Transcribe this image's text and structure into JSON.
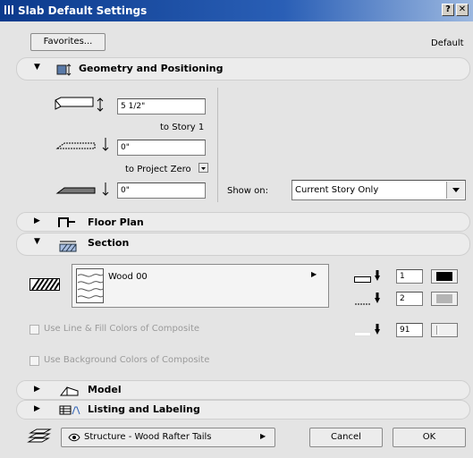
{
  "window": {
    "title": "Slab Default Settings",
    "help_label": "?",
    "close_label": "✕"
  },
  "top": {
    "favorites_label": "Favorites...",
    "mode_label": "Default"
  },
  "geometry": {
    "title": "Geometry and Positioning",
    "thickness_value": "5 1/2\"",
    "to_story_label": "to Story 1",
    "offset1_value": "0\"",
    "to_project_zero_label": "to Project Zero",
    "offset2_value": "0\"",
    "show_on_label": "Show on:",
    "show_on_value": "Current Story Only"
  },
  "floor_plan": {
    "title": "Floor Plan"
  },
  "section": {
    "title": "Section",
    "fill_name": "Wood 00",
    "pen1": "1",
    "pen2": "2",
    "pen3": "91",
    "use_line_fill_label": "Use Line & Fill Colors of Composite",
    "use_bg_label": "Use Background Colors of Composite"
  },
  "model": {
    "title": "Model"
  },
  "listing": {
    "title": "Listing and Labeling"
  },
  "footer": {
    "layer_label": "Structure - Wood Rafter Tails",
    "cancel_label": "Cancel",
    "ok_label": "OK"
  },
  "colors": {
    "title_start": "#0b3a8c",
    "title_end": "#9cb8e0",
    "panel_bg": "#e4e4e4"
  }
}
